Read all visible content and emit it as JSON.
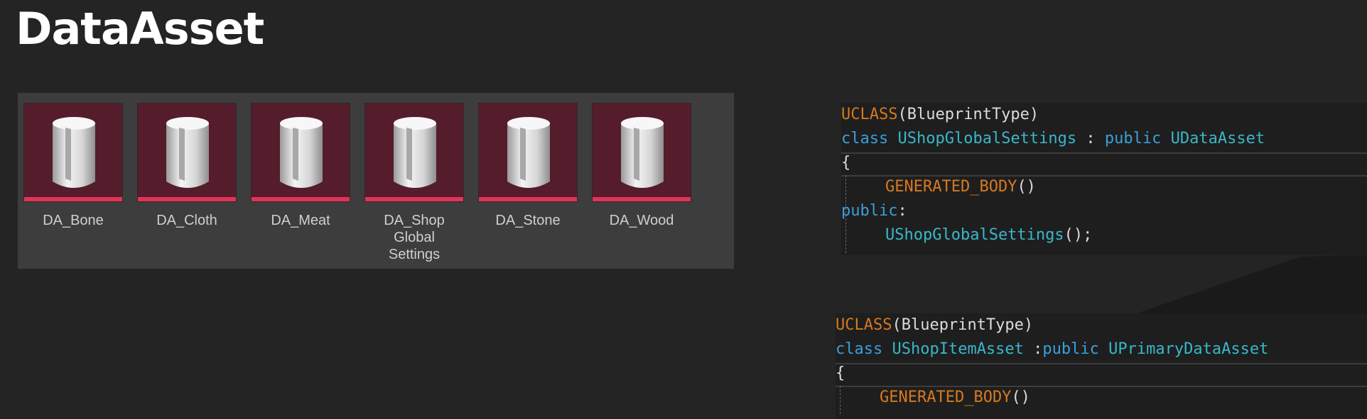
{
  "slide": {
    "title": "DataAsset"
  },
  "assets": [
    {
      "label": "DA_Bone"
    },
    {
      "label": "DA_Cloth"
    },
    {
      "label": "DA_Meat"
    },
    {
      "label": "DA_Shop\nGlobal\nSettings"
    },
    {
      "label": "DA_Stone"
    },
    {
      "label": "DA_Wood"
    }
  ],
  "code_top": {
    "macro": "UCLASS",
    "macro_args": "(BlueprintType)",
    "class_kw": "class",
    "class_name": "UShopGlobalSettings",
    "sep": " : ",
    "public_kw": "public",
    "base": "UDataAsset",
    "brace": "{",
    "generated": "GENERATED_BODY",
    "generated_args": "()",
    "access": "public",
    "colon": ":",
    "ctor": "UShopGlobalSettings",
    "ctor_args": "();"
  },
  "code_bottom": {
    "macro": "UCLASS",
    "macro_args": "(BlueprintType)",
    "class_kw": "class",
    "class_name": "UShopItemAsset",
    "sep": " :",
    "public_kw": "public",
    "base": "UPrimaryDataAsset",
    "brace": "{",
    "generated": "GENERATED_BODY",
    "generated_args": "()"
  },
  "colors": {
    "background": "#242424",
    "tile": "#551c2c",
    "tile_stripe": "#e33358",
    "macro": "#d8791f",
    "keyword": "#3b9fd8",
    "class": "#39b7ca"
  }
}
